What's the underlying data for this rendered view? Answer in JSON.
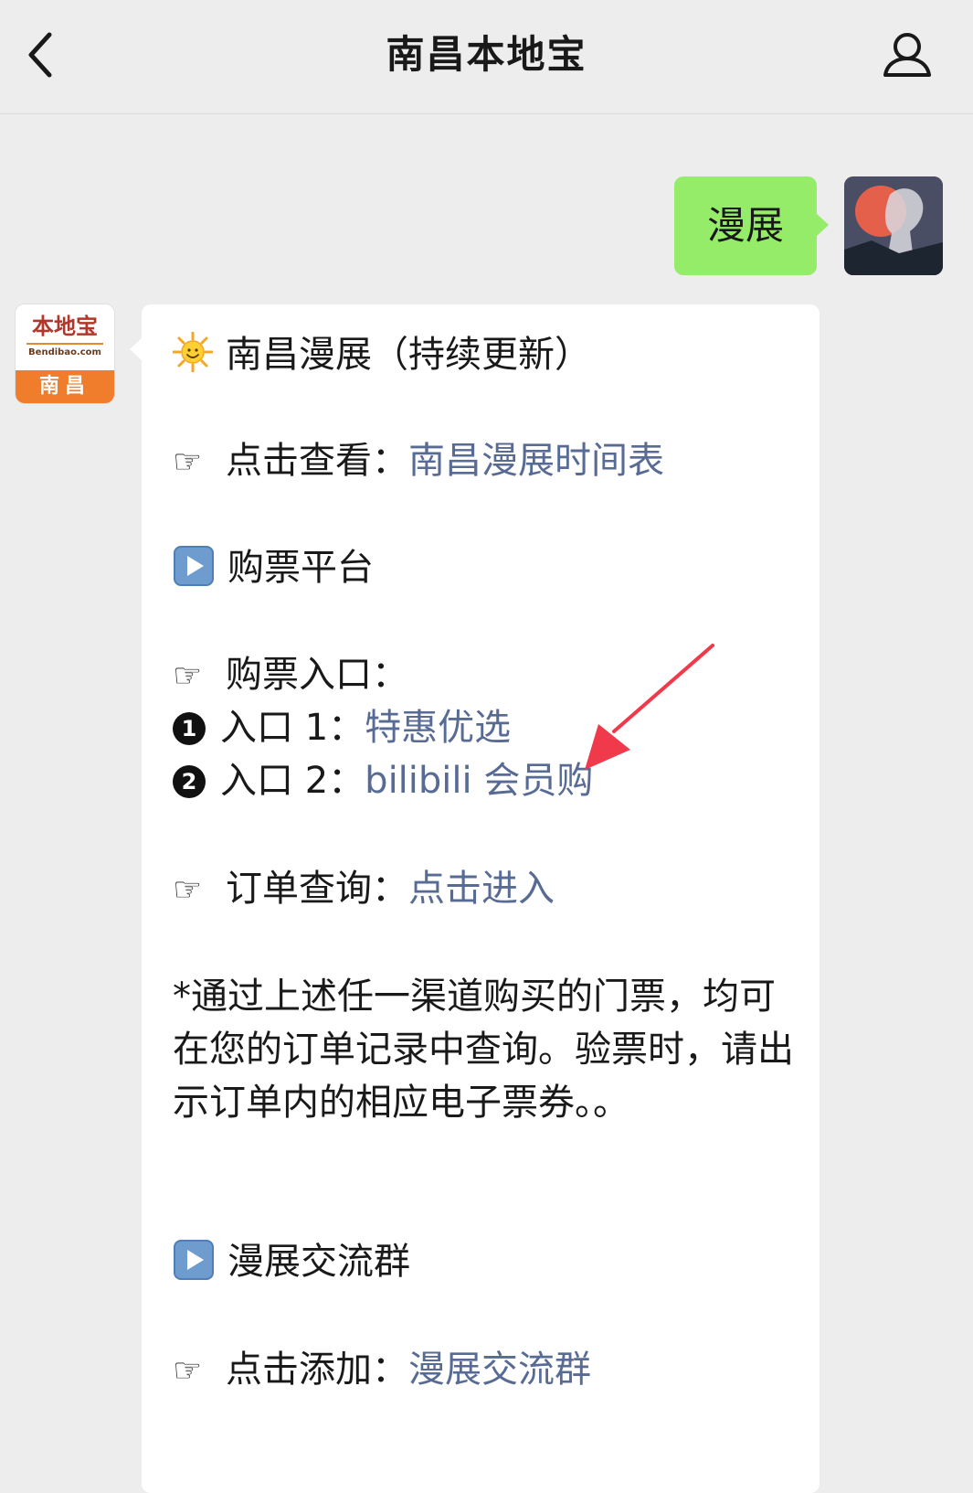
{
  "header": {
    "title": "南昌本地宝",
    "back_icon": "chevron-left-icon",
    "profile_icon": "user-icon"
  },
  "user_message": {
    "text": "漫展",
    "bubble_color": "#95ec69"
  },
  "bot": {
    "avatar": {
      "logo_main": "本地宝",
      "logo_sub": "Bendibao.com",
      "logo_city": "南昌"
    },
    "heading": {
      "icon": "sun-emoji-icon",
      "text": "南昌漫展（持续更新）"
    },
    "view_schedule": {
      "icon": "pointing-hand-icon",
      "label": "点击查看：",
      "link": "南昌漫展时间表"
    },
    "section_ticket": {
      "icon": "play-button-icon",
      "text": "购票平台"
    },
    "ticket_entry": {
      "icon": "pointing-hand-icon",
      "label": "购票入口："
    },
    "entry1": {
      "num": "1",
      "label": "入口 1：",
      "link": "特惠优选"
    },
    "entry2": {
      "num": "2",
      "label": "入口 2：",
      "link": "bilibili 会员购"
    },
    "order_query": {
      "icon": "pointing-hand-icon",
      "label": "订单查询：",
      "link": "点击进入"
    },
    "note": "*通过上述任一渠道购买的门票，均可在您的订单记录中查询。验票时，请出示订单内的相应电子票券。。",
    "section_group": {
      "icon": "play-button-icon",
      "text": "漫展交流群"
    },
    "add_group": {
      "icon": "pointing-hand-icon",
      "label": "点击添加：",
      "link": "漫展交流群"
    }
  },
  "colors": {
    "link": "#576b95",
    "background": "#ededed",
    "annotation_arrow": "#f0394a"
  }
}
